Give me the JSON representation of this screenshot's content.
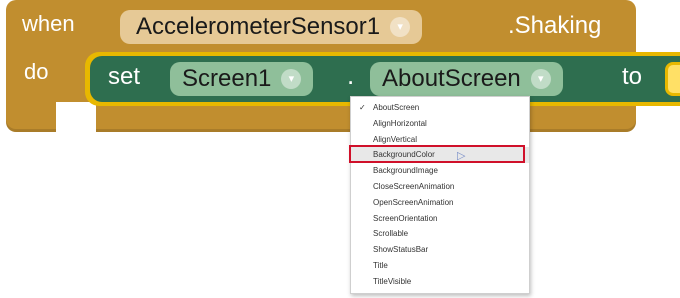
{
  "event_block": {
    "when_label": "when",
    "component": "AccelerometerSensor1",
    "event": ".Shaking",
    "do_label": "do",
    "color": "#c18e2f"
  },
  "setter_block": {
    "set_label": "set",
    "component": "Screen1",
    "dot": ".",
    "property": "AboutScreen",
    "to_label": "to",
    "color": "#2e6e4f"
  },
  "dropdown_arrow": "▾",
  "menu": {
    "selected_check": "✓",
    "items": [
      "AboutScreen",
      "AlignHorizontal",
      "AlignVertical",
      "BackgroundColor",
      "BackgroundImage",
      "CloseScreenAnimation",
      "OpenScreenAnimation",
      "ScreenOrientation",
      "Scrollable",
      "ShowStatusBar",
      "Title",
      "TitleVisible"
    ],
    "selected_index": 0,
    "hovered_index": 3,
    "highlight_color": "#d0102a"
  },
  "cursor_icon": "pointer-cursor-icon"
}
